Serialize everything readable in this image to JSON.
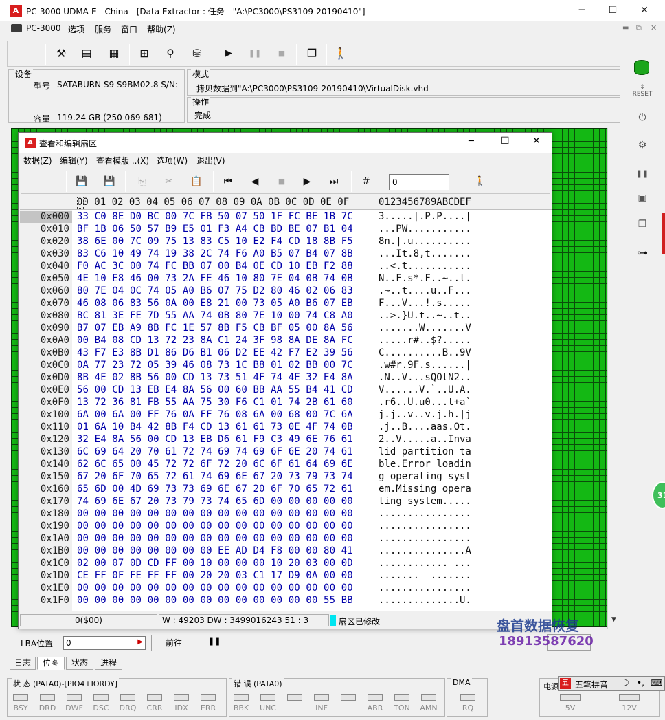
{
  "window": {
    "title": "PC-3000 UDMA-E - China - [Data Extractor : 任务 - \"A:\\PC3000\\PS3109-20190410\"]",
    "app_icon": "pc3000-icon",
    "minimize": "─",
    "maximize": "☐",
    "close": "✕"
  },
  "menu": {
    "items": [
      "PC-3000",
      "选项",
      "服务",
      "窗口",
      "帮助(Z)"
    ],
    "mdi_min": "▬",
    "mdi_restore": "⧉",
    "mdi_close": "✕"
  },
  "device_panel": {
    "header": "设备",
    "model_label": "型号",
    "model_value": "SATABURN   S9 S9BM02.8 S/N:",
    "capacity_label": "容量",
    "capacity_value": "119.24 GB (250 069 681)"
  },
  "mode_panel": {
    "header": "模式",
    "value": "拷贝数据到\"A:\\PC3000\\PS3109-20190410\\VirtualDisk.vhd"
  },
  "operation_panel": {
    "header": "操作",
    "value": "完成"
  },
  "dialog": {
    "title": "查看和编辑扇区",
    "menu": [
      "数据(Z)",
      "编辑(Y)",
      "查看模版 ..(X)",
      "选项(W)",
      "退出(V)"
    ],
    "goto_value": "0",
    "header_hex": "00 01 02 03 04 05 06 07 08 09 0A 0B 0C 0D 0E 0F",
    "header_ascii": "0123456789ABCDEF",
    "rows": [
      {
        "addr": "0x000",
        "hex": "33 C0 8E D0 BC 00 7C FB 50 07 50 1F FC BE 1B 7C",
        "ascii": "3.....|.P.P....|"
      },
      {
        "addr": "0x010",
        "hex": "BF 1B 06 50 57 B9 E5 01 F3 A4 CB BD BE 07 B1 04",
        "ascii": "...PW..........."
      },
      {
        "addr": "0x020",
        "hex": "38 6E 00 7C 09 75 13 83 C5 10 E2 F4 CD 18 8B F5",
        "ascii": "8n.|.u.........."
      },
      {
        "addr": "0x030",
        "hex": "83 C6 10 49 74 19 38 2C 74 F6 A0 B5 07 B4 07 8B",
        "ascii": "...It.8,t......."
      },
      {
        "addr": "0x040",
        "hex": "F0 AC 3C 00 74 FC BB 07 00 B4 0E CD 10 EB F2 88",
        "ascii": "..<.t..........."
      },
      {
        "addr": "0x050",
        "hex": "4E 10 E8 46 00 73 2A FE 46 10 80 7E 04 0B 74 0B",
        "ascii": "N..F.s*.F..~..t."
      },
      {
        "addr": "0x060",
        "hex": "80 7E 04 0C 74 05 A0 B6 07 75 D2 80 46 02 06 83",
        "ascii": ".~..t....u..F..."
      },
      {
        "addr": "0x070",
        "hex": "46 08 06 83 56 0A 00 E8 21 00 73 05 A0 B6 07 EB",
        "ascii": "F...V...!.s....."
      },
      {
        "addr": "0x080",
        "hex": "BC 81 3E FE 7D 55 AA 74 0B 80 7E 10 00 74 C8 A0",
        "ascii": "..>.}U.t..~..t.."
      },
      {
        "addr": "0x090",
        "hex": "B7 07 EB A9 8B FC 1E 57 8B F5 CB BF 05 00 8A 56",
        "ascii": ".......W.......V"
      },
      {
        "addr": "0x0A0",
        "hex": "00 B4 08 CD 13 72 23 8A C1 24 3F 98 8A DE 8A FC",
        "ascii": ".....r#..$?....."
      },
      {
        "addr": "0x0B0",
        "hex": "43 F7 E3 8B D1 86 D6 B1 06 D2 EE 42 F7 E2 39 56",
        "ascii": "C..........B..9V"
      },
      {
        "addr": "0x0C0",
        "hex": "0A 77 23 72 05 39 46 08 73 1C B8 01 02 BB 00 7C",
        "ascii": ".w#r.9F.s......|"
      },
      {
        "addr": "0x0D0",
        "hex": "8B 4E 02 8B 56 00 CD 13 73 51 4F 74 4E 32 E4 8A",
        "ascii": ".N..V...sQOtN2.."
      },
      {
        "addr": "0x0E0",
        "hex": "56 00 CD 13 EB E4 8A 56 00 60 BB AA 55 B4 41 CD",
        "ascii": "V......V.`..U.A."
      },
      {
        "addr": "0x0F0",
        "hex": "13 72 36 81 FB 55 AA 75 30 F6 C1 01 74 2B 61 60",
        "ascii": ".r6..U.u0...t+a`"
      },
      {
        "addr": "0x100",
        "hex": "6A 00 6A 00 FF 76 0A FF 76 08 6A 00 68 00 7C 6A",
        "ascii": "j.j..v..v.j.h.|j"
      },
      {
        "addr": "0x110",
        "hex": "01 6A 10 B4 42 8B F4 CD 13 61 61 73 0E 4F 74 0B",
        "ascii": ".j..B....aas.Ot."
      },
      {
        "addr": "0x120",
        "hex": "32 E4 8A 56 00 CD 13 EB D6 61 F9 C3 49 6E 76 61",
        "ascii": "2..V.....a..Inva"
      },
      {
        "addr": "0x130",
        "hex": "6C 69 64 20 70 61 72 74 69 74 69 6F 6E 20 74 61",
        "ascii": "lid partition ta"
      },
      {
        "addr": "0x140",
        "hex": "62 6C 65 00 45 72 72 6F 72 20 6C 6F 61 64 69 6E",
        "ascii": "ble.Error loadin"
      },
      {
        "addr": "0x150",
        "hex": "67 20 6F 70 65 72 61 74 69 6E 67 20 73 79 73 74",
        "ascii": "g operating syst"
      },
      {
        "addr": "0x160",
        "hex": "65 6D 00 4D 69 73 73 69 6E 67 20 6F 70 65 72 61",
        "ascii": "em.Missing opera"
      },
      {
        "addr": "0x170",
        "hex": "74 69 6E 67 20 73 79 73 74 65 6D 00 00 00 00 00",
        "ascii": "ting system....."
      },
      {
        "addr": "0x180",
        "hex": "00 00 00 00 00 00 00 00 00 00 00 00 00 00 00 00",
        "ascii": "................"
      },
      {
        "addr": "0x190",
        "hex": "00 00 00 00 00 00 00 00 00 00 00 00 00 00 00 00",
        "ascii": "................"
      },
      {
        "addr": "0x1A0",
        "hex": "00 00 00 00 00 00 00 00 00 00 00 00 00 00 00 00",
        "ascii": "................"
      },
      {
        "addr": "0x1B0",
        "hex": "00 00 00 00 00 00 00 00 EE AD D4 F8 00 00 80 41",
        "ascii": "...............A"
      },
      {
        "addr": "0x1C0",
        "hex": "02 00 07 0D CD FF 00 10 00 00 00 10 20 03 00 0D",
        "ascii": "............ ..."
      },
      {
        "addr": "0x1D0",
        "hex": "CE FF 0F FE FF FF 00 20 20 03 C1 17 D9 0A 00 00",
        "ascii": ".......  ......."
      },
      {
        "addr": "0x1E0",
        "hex": "00 00 00 00 00 00 00 00 00 00 00 00 00 00 00 00",
        "ascii": "................"
      },
      {
        "addr": "0x1F0",
        "hex": "00 00 00 00 00 00 00 00 00 00 00 00 00 00 55 BB",
        "ascii": "..............U."
      }
    ],
    "status_offset": "0($00)",
    "status_crc": "3 : 51 W : 49203 DW : 3499016243",
    "status_modified": "扇区已修改"
  },
  "lba": {
    "label": "LBA位置",
    "value": "0",
    "forward_label": "前往",
    "pause": "❚❚"
  },
  "watermark": {
    "line1": "盘首数据恢复",
    "line2": "18913587620"
  },
  "tabs": [
    "日志",
    "位图",
    "状态",
    "进程"
  ],
  "status_box": {
    "title": "状 态 (PATA0)-[PIO4+IORDY]",
    "leds": [
      "BSY",
      "DRD",
      "DWF",
      "DSC",
      "DRQ",
      "CRR",
      "IDX",
      "ERR"
    ]
  },
  "error_box": {
    "title": "错 误 (PATA0)",
    "leds": [
      "BBK",
      "UNC",
      "",
      "INF",
      "",
      "ABR",
      "TON",
      "AMN"
    ]
  },
  "dma_box": {
    "title": "DMA",
    "leds": [
      "RQ"
    ]
  },
  "power_box": {
    "title": "电源",
    "leds": [
      "5V",
      "12V"
    ]
  },
  "ime": {
    "label": "五笔拼音"
  },
  "colors": {
    "grid_green": "#14b814",
    "hex_blue": "#0000aa",
    "modified_cyan": "#00e5f0",
    "app_red": "#d81e1e"
  }
}
